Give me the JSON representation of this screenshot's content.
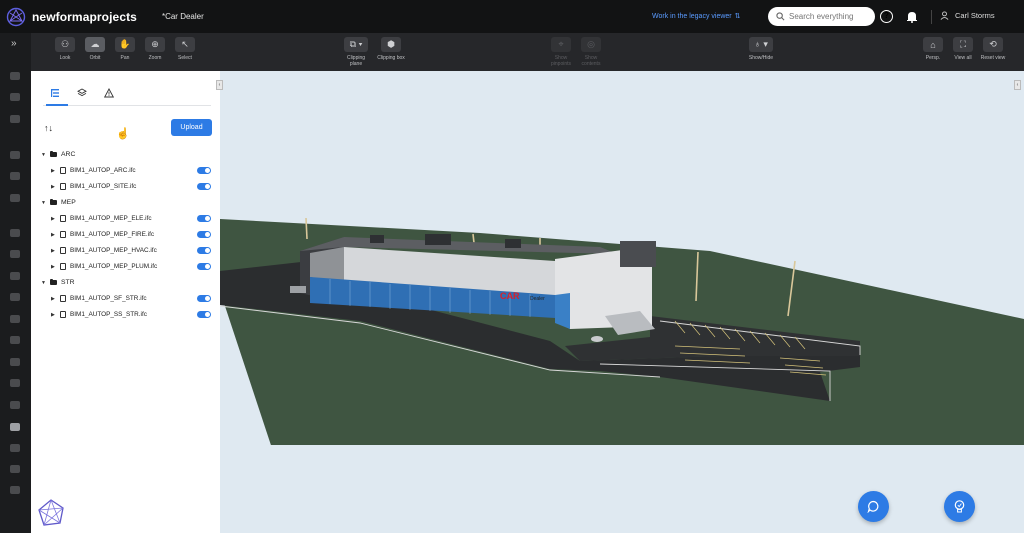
{
  "header": {
    "brand": "newformaprojects",
    "project_title": "*Car Dealer",
    "legacy_link": "Work in the legacy viewer",
    "search_placeholder": "Search everything",
    "user_name": "Carl Storms"
  },
  "toolbar": {
    "groups": [
      {
        "label": "Look",
        "icon": "person-icon"
      },
      {
        "label": "Orbit",
        "icon": "orbit-icon",
        "active": true
      },
      {
        "label": "Pan",
        "icon": "hand-icon"
      },
      {
        "label": "Zoom",
        "icon": "zoom-icon"
      },
      {
        "label": "Select",
        "icon": "cursor-icon"
      }
    ],
    "clipping_plane": "Clipping plane",
    "clipping_box": "Clipping box",
    "show_pinpoints": "Show pinpoints",
    "show_contents": "Show contents",
    "show_hide": "Show/Hide",
    "persp": "Persp.",
    "view_all": "View all",
    "reset_view": "Reset view"
  },
  "panel": {
    "upload_label": "Upload",
    "sort_glyph": "↑↓",
    "folders": [
      {
        "name": "ARC",
        "files": [
          "BIM1_AUTOP_ARC.ifc",
          "BIM1_AUTOP_SITE.ifc"
        ]
      },
      {
        "name": "MEP",
        "files": [
          "BIM1_AUTOP_MEP_ELE.ifc",
          "BIM1_AUTOP_MEP_FIRE.ifc",
          "BIM1_AUTOP_MEP_HVAC.ifc",
          "BIM1_AUTOP_MEP_PLUM.ifc"
        ]
      },
      {
        "name": "STR",
        "files": [
          "BIM1_AUTOP_SF_STR.ifc",
          "BIM1_AUTOP_SS_STR.ifc"
        ]
      }
    ]
  },
  "model": {
    "sign_car": "CAR",
    "sign_dealer": "Dealer"
  },
  "colors": {
    "accent": "#2d7be5",
    "topbar": "#121314",
    "toolbar": "#26272a",
    "sky": "#dfe9f1",
    "grass": "#3f5541",
    "asphalt": "#2b2d2f"
  }
}
